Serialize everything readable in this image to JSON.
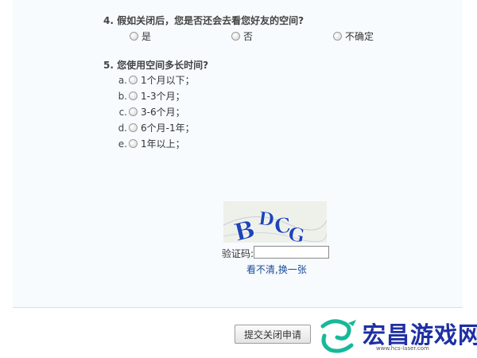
{
  "questions": [
    {
      "title": "4. 假如关闭后，您是否还会去看您好友的空间?",
      "options": [
        {
          "label": "是"
        },
        {
          "label": "否"
        },
        {
          "label": "不确定"
        }
      ]
    },
    {
      "title": "5. 您使用空间多长时间?",
      "options": [
        {
          "letter": "a.",
          "label": "1个月以下；"
        },
        {
          "letter": "b.",
          "label": "1-3个月；"
        },
        {
          "letter": "c.",
          "label": "3-6个月；"
        },
        {
          "letter": "d.",
          "label": "6个月-1年；"
        },
        {
          "letter": "e.",
          "label": "1年以上；"
        }
      ]
    }
  ],
  "captcha": {
    "image_text": "BDCG",
    "label": "验证码:",
    "input_value": "",
    "refresh_link": "看不清,换一张"
  },
  "submit_label": "提交关闭申请",
  "watermark": {
    "name": "宏昌游戏网",
    "url": "www.hcs-laser.com"
  },
  "colors": {
    "panel_bg": "#f7fbfd",
    "link": "#1a4a9a",
    "captcha_letters": "#1e44b8",
    "brand": "#1e2fa3",
    "brand_logo": "#18b89a"
  }
}
